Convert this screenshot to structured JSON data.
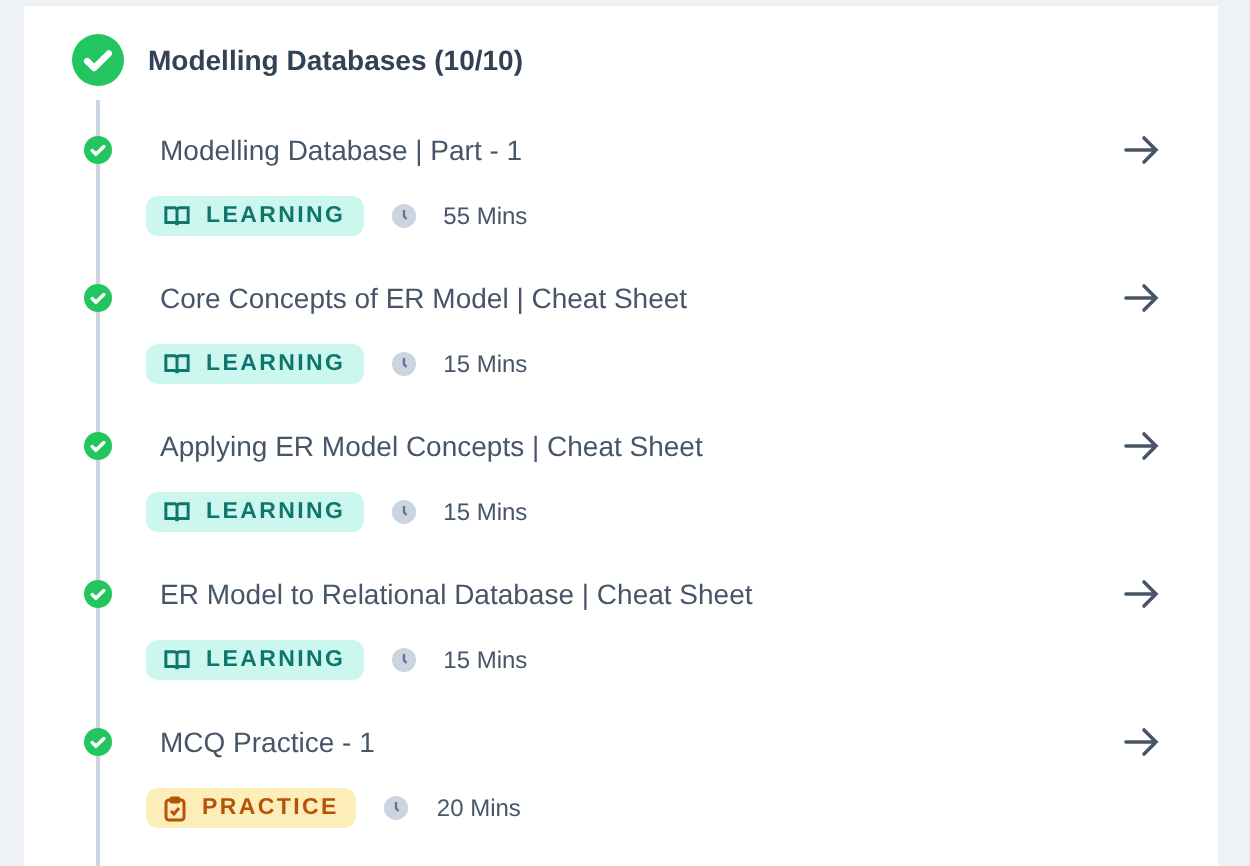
{
  "module": {
    "title": "Modelling Databases (10/10)",
    "completed": true
  },
  "items": [
    {
      "title": "Modelling Database | Part - 1",
      "completed": true,
      "kind": "learning",
      "tag": "LEARNING",
      "duration": "55 Mins"
    },
    {
      "title": "Core Concepts of ER Model | Cheat Sheet",
      "completed": true,
      "kind": "learning",
      "tag": "LEARNING",
      "duration": "15 Mins"
    },
    {
      "title": "Applying ER Model Concepts | Cheat Sheet",
      "completed": true,
      "kind": "learning",
      "tag": "LEARNING",
      "duration": "15 Mins"
    },
    {
      "title": "ER Model to Relational Database | Cheat Sheet",
      "completed": true,
      "kind": "learning",
      "tag": "LEARNING",
      "duration": "15 Mins"
    },
    {
      "title": "MCQ Practice - 1",
      "completed": true,
      "kind": "practice",
      "tag": "PRACTICE",
      "duration": "20 Mins"
    }
  ]
}
